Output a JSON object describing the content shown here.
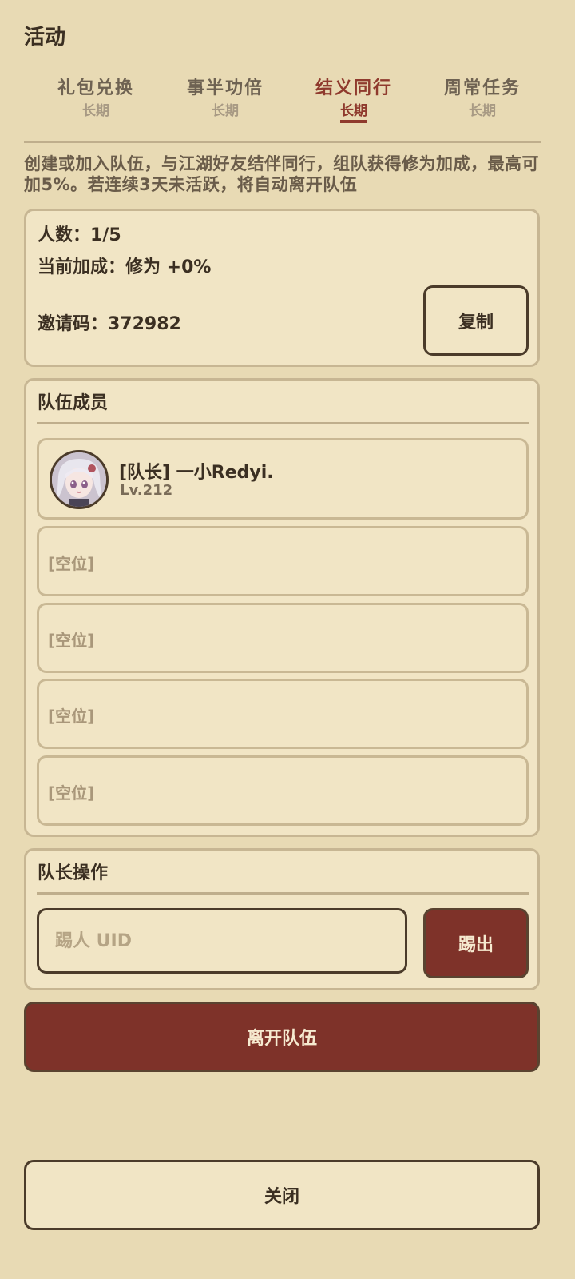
{
  "header": {
    "title": "活动"
  },
  "tabs": [
    {
      "label": "礼包兑换",
      "sub": "长期"
    },
    {
      "label": "事半功倍",
      "sub": "长期"
    },
    {
      "label": "结义同行",
      "sub": "长期"
    },
    {
      "label": "周常任务",
      "sub": "长期"
    }
  ],
  "active_tab": "结义同行",
  "description": "创建或加入队伍，与江湖好友结伴同行，组队获得修为加成，最高可加5%。若连续3天未活跃，将自动离开队伍",
  "team_info": {
    "count": "人数：1/5",
    "bonus": "当前加成：修为 +0%",
    "invite_code": "邀请码：372982",
    "copy_label": "复制"
  },
  "members": {
    "title": "队伍成员",
    "leader": {
      "name": "[队长] 一小Redyi.",
      "level": "Lv.212"
    },
    "empty_slots": [
      "[空位]",
      "[空位]",
      "[空位]",
      "[空位]"
    ]
  },
  "leader_ops": {
    "title": "队长操作",
    "kick_placeholder": "踢人 UID",
    "kick_label": "踢出"
  },
  "leave_label": "离开队伍",
  "close_label": "关闭",
  "colors": {
    "accent": "#7e3229",
    "background": "#e8dab4",
    "card": "#f1e5c5"
  }
}
